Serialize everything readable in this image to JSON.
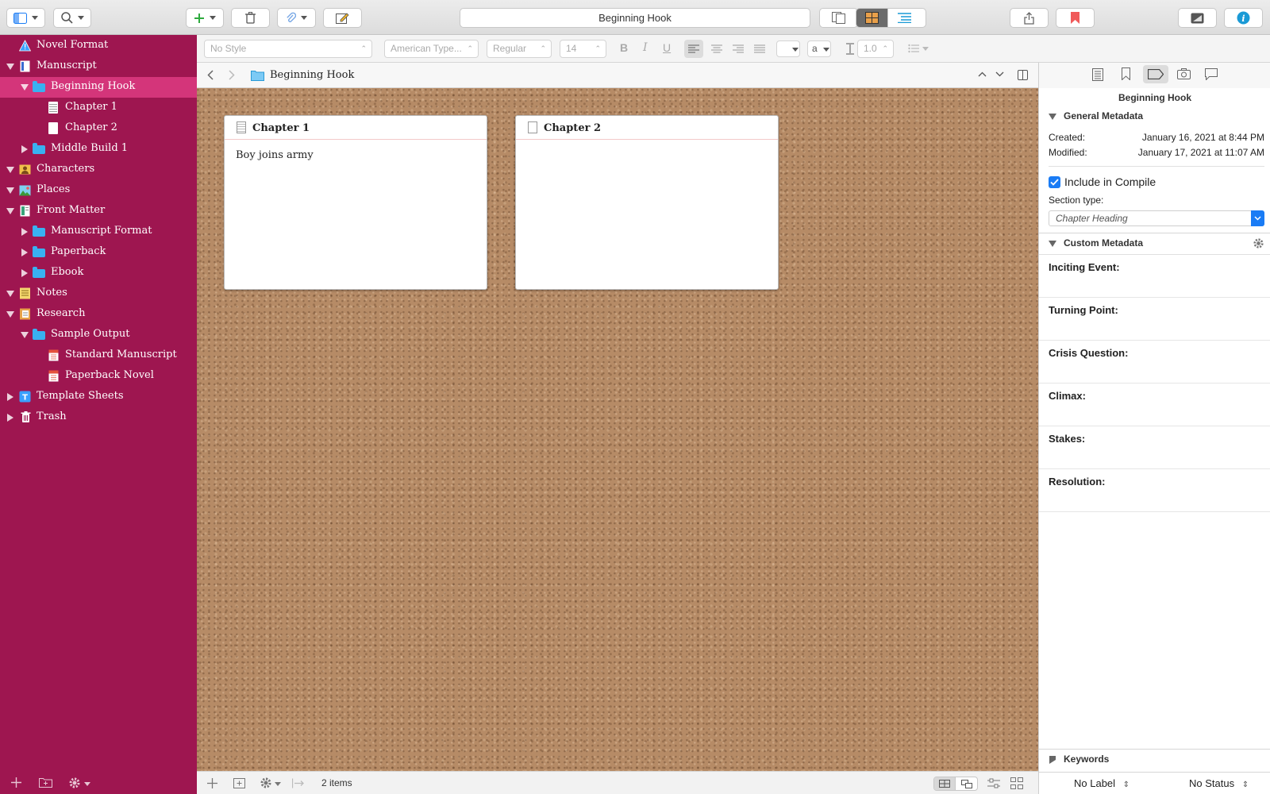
{
  "toolbar": {
    "title": "Beginning Hook"
  },
  "binder": {
    "items": [
      {
        "label": "Novel Format",
        "icon": "warning-icon"
      },
      {
        "label": "Manuscript",
        "icon": "manuscript-icon"
      },
      {
        "label": "Beginning Hook",
        "icon": "folder-icon"
      },
      {
        "label": "Chapter 1",
        "icon": "document-icon"
      },
      {
        "label": "Chapter 2",
        "icon": "blank-document-icon"
      },
      {
        "label": "Middle Build 1",
        "icon": "folder-icon"
      },
      {
        "label": "Characters",
        "icon": "characters-icon"
      },
      {
        "label": "Places",
        "icon": "places-icon"
      },
      {
        "label": "Front Matter",
        "icon": "front-matter-icon"
      },
      {
        "label": "Manuscript Format",
        "icon": "folder-icon"
      },
      {
        "label": "Paperback",
        "icon": "folder-icon"
      },
      {
        "label": "Ebook",
        "icon": "folder-icon"
      },
      {
        "label": "Notes",
        "icon": "notes-icon"
      },
      {
        "label": "Research",
        "icon": "research-icon"
      },
      {
        "label": "Sample Output",
        "icon": "folder-icon"
      },
      {
        "label": "Standard Manuscript",
        "icon": "pdf-icon"
      },
      {
        "label": "Paperback Novel",
        "icon": "pdf-icon"
      },
      {
        "label": "Template Sheets",
        "icon": "template-icon"
      },
      {
        "label": "Trash",
        "icon": "trash-icon"
      }
    ]
  },
  "formatbar": {
    "style": "No Style",
    "font": "American Type...",
    "weight": "Regular",
    "size": "14",
    "bold": "B",
    "italic": "I",
    "underline": "U",
    "highlight": "a",
    "line_spacing": "1.0"
  },
  "header": {
    "title": "Beginning Hook"
  },
  "cards": [
    {
      "title": "Chapter 1",
      "synopsis": "Boy joins army"
    },
    {
      "title": "Chapter 2",
      "synopsis": ""
    }
  ],
  "editor_footer": {
    "count": "2 items"
  },
  "inspector": {
    "title": "Beginning Hook",
    "general_label": "General Metadata",
    "created_label": "Created:",
    "created_value": "January 16, 2021 at 8:44 PM",
    "modified_label": "Modified:",
    "modified_value": "January 17, 2021 at 11:07 AM",
    "include_label": "Include in Compile",
    "include_checked": true,
    "section_type_label": "Section type:",
    "section_type_value": "Chapter Heading",
    "custom_label": "Custom Metadata",
    "custom_fields": [
      "Inciting Event:",
      "Turning Point:",
      "Crisis Question:",
      "Climax:",
      "Stakes:",
      "Resolution:"
    ],
    "keywords_label": "Keywords",
    "label_select": "No Label",
    "status_select": "No Status"
  },
  "colors": {
    "binder_bg": "#9e1650",
    "binder_selected": "#d4357a",
    "accent": "#1a7cf5"
  }
}
